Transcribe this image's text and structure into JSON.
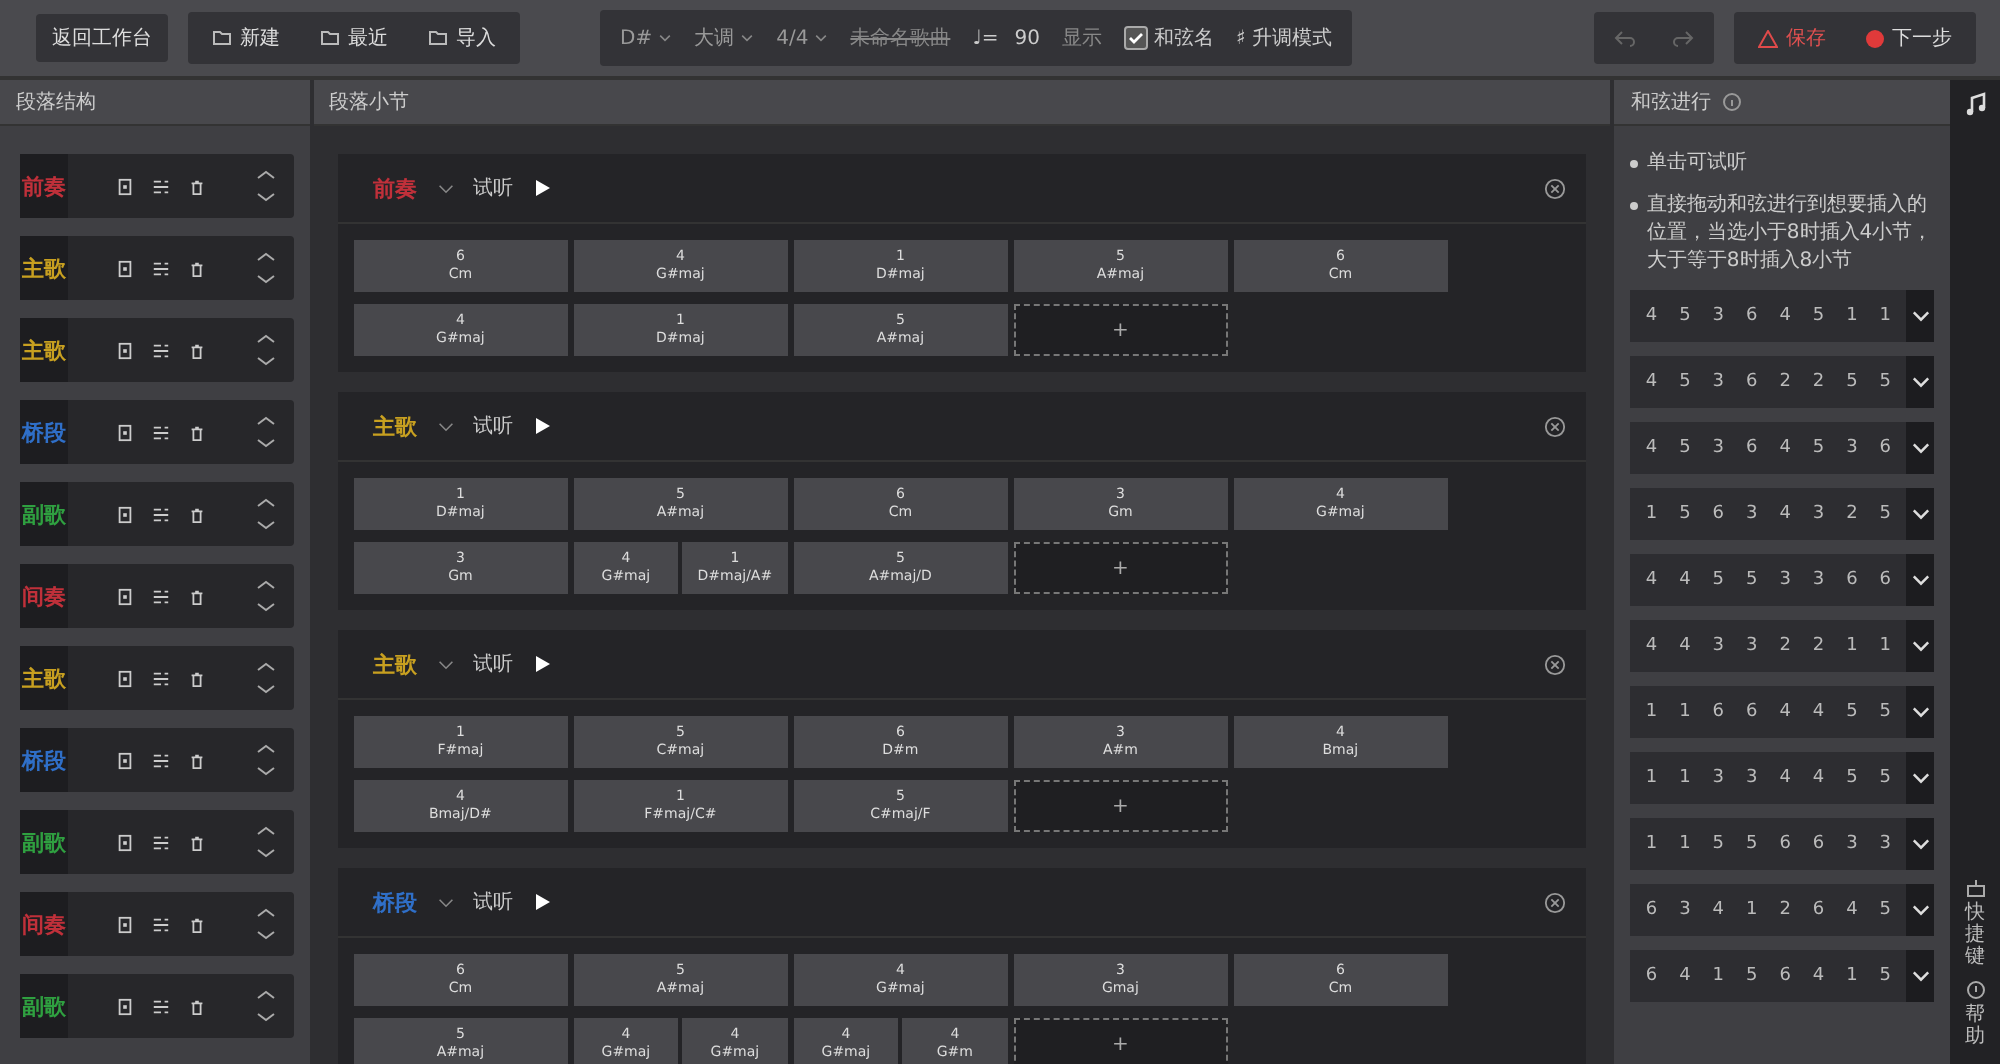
{
  "toolbar": {
    "back_button": "返回工作台",
    "file_buttons": [
      "新建",
      "最近",
      "导入"
    ],
    "key": "D#",
    "mode": "大调",
    "meter": "4/4",
    "song_title": "未命名歌曲",
    "tempo_symbol": "♩=",
    "tempo": "90",
    "display_label": "显示",
    "chord_name_option": {
      "label": "和弦名",
      "checked": true
    },
    "sharp_mode": "♯ 升调模式",
    "save_button": "保存",
    "next_button": "下一步"
  },
  "structure_panel": {
    "title": "段落结构",
    "items": [
      {
        "label": "前奏",
        "color": "#c0303a"
      },
      {
        "label": "主歌",
        "color": "#c8a020"
      },
      {
        "label": "主歌",
        "color": "#c8a020"
      },
      {
        "label": "桥段",
        "color": "#2f6fc8"
      },
      {
        "label": "副歌",
        "color": "#2fa040"
      },
      {
        "label": "间奏",
        "color": "#c0303a"
      },
      {
        "label": "主歌",
        "color": "#c8a020"
      },
      {
        "label": "桥段",
        "color": "#2f6fc8"
      },
      {
        "label": "副歌",
        "color": "#2fa040"
      },
      {
        "label": "间奏",
        "color": "#c0303a"
      },
      {
        "label": "副歌",
        "color": "#2fa040"
      }
    ]
  },
  "bars_panel": {
    "title": "段落小节",
    "sections": [
      {
        "label": "前奏",
        "color": "#c0303a",
        "listen_label": "试听",
        "add_label": "+",
        "bars": [
          [
            {
              "degree": "6",
              "name": "Cm"
            }
          ],
          [
            {
              "degree": "4",
              "name": "G#maj"
            }
          ],
          [
            {
              "degree": "1",
              "name": "D#maj"
            }
          ],
          [
            {
              "degree": "5",
              "name": "A#maj"
            }
          ],
          [
            {
              "degree": "6",
              "name": "Cm"
            }
          ],
          [
            {
              "degree": "4",
              "name": "G#maj"
            }
          ],
          [
            {
              "degree": "1",
              "name": "D#maj"
            }
          ],
          [
            {
              "degree": "5",
              "name": "A#maj"
            }
          ]
        ]
      },
      {
        "label": "主歌",
        "color": "#c8a020",
        "listen_label": "试听",
        "add_label": "+",
        "bars": [
          [
            {
              "degree": "1",
              "name": "D#maj"
            }
          ],
          [
            {
              "degree": "5",
              "name": "A#maj"
            }
          ],
          [
            {
              "degree": "6",
              "name": "Cm"
            }
          ],
          [
            {
              "degree": "3",
              "name": "Gm"
            }
          ],
          [
            {
              "degree": "4",
              "name": "G#maj"
            }
          ],
          [
            {
              "degree": "3",
              "name": "Gm"
            }
          ],
          [
            {
              "degree": "4",
              "name": "G#maj"
            },
            {
              "degree": "1",
              "name": "D#maj/A#"
            }
          ],
          [
            {
              "degree": "5",
              "name": "A#maj/D"
            }
          ]
        ]
      },
      {
        "label": "主歌",
        "color": "#c8a020",
        "listen_label": "试听",
        "add_label": "+",
        "bars": [
          [
            {
              "degree": "1",
              "name": "F#maj"
            }
          ],
          [
            {
              "degree": "5",
              "name": "C#maj"
            }
          ],
          [
            {
              "degree": "6",
              "name": "D#m"
            }
          ],
          [
            {
              "degree": "3",
              "name": "A#m"
            }
          ],
          [
            {
              "degree": "4",
              "name": "Bmaj"
            }
          ],
          [
            {
              "degree": "4",
              "name": "Bmaj/D#"
            }
          ],
          [
            {
              "degree": "1",
              "name": "F#maj/C#"
            }
          ],
          [
            {
              "degree": "5",
              "name": "C#maj/F"
            }
          ]
        ]
      },
      {
        "label": "桥段",
        "color": "#2f6fc8",
        "listen_label": "试听",
        "add_label": "+",
        "bars": [
          [
            {
              "degree": "6",
              "name": "Cm"
            }
          ],
          [
            {
              "degree": "5",
              "name": "A#maj"
            }
          ],
          [
            {
              "degree": "4",
              "name": "G#maj"
            }
          ],
          [
            {
              "degree": "3",
              "name": "Gmaj"
            }
          ],
          [
            {
              "degree": "6",
              "name": "Cm"
            }
          ],
          [
            {
              "degree": "5",
              "name": "A#maj"
            }
          ],
          [
            {
              "degree": "4",
              "name": "G#maj"
            },
            {
              "degree": "4",
              "name": "G#maj"
            }
          ],
          [
            {
              "degree": "4",
              "name": "G#maj"
            },
            {
              "degree": "4",
              "name": "G#m"
            }
          ]
        ]
      }
    ]
  },
  "progression_panel": {
    "title": "和弦进行",
    "tips": [
      "单击可试听",
      "直接拖动和弦进行到想要插入的位置，当选小于8时插入4小节，大于等于8时插入8小节"
    ],
    "progressions": [
      [
        "4",
        "5",
        "3",
        "6",
        "4",
        "5",
        "1",
        "1"
      ],
      [
        "4",
        "5",
        "3",
        "6",
        "2",
        "2",
        "5",
        "5"
      ],
      [
        "4",
        "5",
        "3",
        "6",
        "4",
        "5",
        "3",
        "6"
      ],
      [
        "1",
        "5",
        "6",
        "3",
        "4",
        "3",
        "2",
        "5"
      ],
      [
        "4",
        "4",
        "5",
        "5",
        "3",
        "3",
        "6",
        "6"
      ],
      [
        "4",
        "4",
        "3",
        "3",
        "2",
        "2",
        "1",
        "1"
      ],
      [
        "1",
        "1",
        "6",
        "6",
        "4",
        "4",
        "5",
        "5"
      ],
      [
        "1",
        "1",
        "3",
        "3",
        "4",
        "4",
        "5",
        "5"
      ],
      [
        "1",
        "1",
        "5",
        "5",
        "6",
        "6",
        "3",
        "3"
      ],
      [
        "6",
        "3",
        "4",
        "1",
        "2",
        "6",
        "4",
        "5"
      ],
      [
        "6",
        "4",
        "1",
        "5",
        "6",
        "4",
        "1",
        "5"
      ]
    ]
  },
  "side_strip": {
    "shortcuts": "快捷键",
    "help": "帮助"
  }
}
